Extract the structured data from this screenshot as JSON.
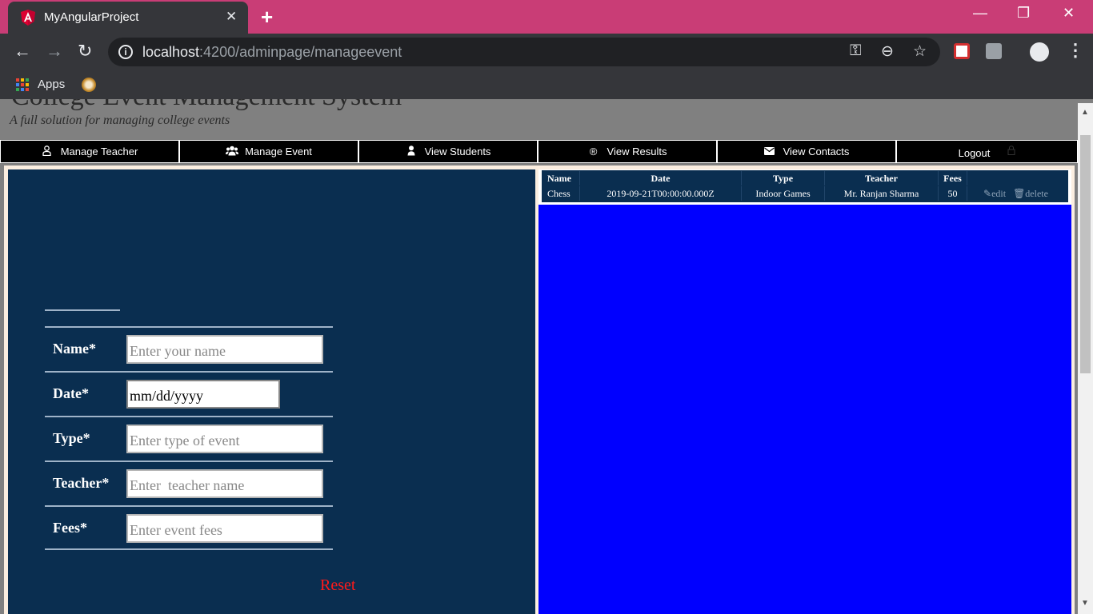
{
  "browser": {
    "tab_title": "MyAngularProject",
    "tab_close": "✕",
    "new_tab": "+",
    "url_host": "localhost",
    "url_path": ":4200/adminpage/manageevent",
    "bookmarks": {
      "apps_label": "Apps"
    }
  },
  "site": {
    "title": "College Event Management System",
    "subtitle": "A full solution for managing college events"
  },
  "nav": {
    "items": [
      {
        "label": "Manage Teacher",
        "icon": "user-icon"
      },
      {
        "label": "Manage Event",
        "icon": "users-icon"
      },
      {
        "label": "View Students",
        "icon": "person-icon"
      },
      {
        "label": "View Results",
        "icon": "registered-icon"
      },
      {
        "label": "View Contacts",
        "icon": "envelope-icon"
      },
      {
        "label": "Logout",
        "icon": "lock-icon"
      }
    ]
  },
  "form": {
    "fields": [
      {
        "label": "Name*",
        "placeholder": "Enter your name"
      },
      {
        "label": "Date*",
        "value": "mm/dd/yyyy"
      },
      {
        "label": "Type*",
        "placeholder": "Enter type of event"
      },
      {
        "label": "Teacher*",
        "placeholder": "Enter  teacher name"
      },
      {
        "label": "Fees*",
        "placeholder": "Enter event fees"
      }
    ],
    "reset_label": "Reset"
  },
  "events_table": {
    "headers": [
      "Name",
      "Date",
      "Type",
      "Teacher",
      "Fees"
    ],
    "rows": [
      {
        "name": "Chess",
        "date": "2019-09-21T00:00:00.000Z",
        "type": "Indoor Games",
        "teacher": "Mr. Ranjan Sharma",
        "fees": "50",
        "edit": "edit",
        "delete": "delete"
      }
    ]
  },
  "colors": {
    "tabbar": "#c93d76",
    "panel": "#0a2e50",
    "blue_area": "#0000ff",
    "reset": "#ff1a1a"
  }
}
